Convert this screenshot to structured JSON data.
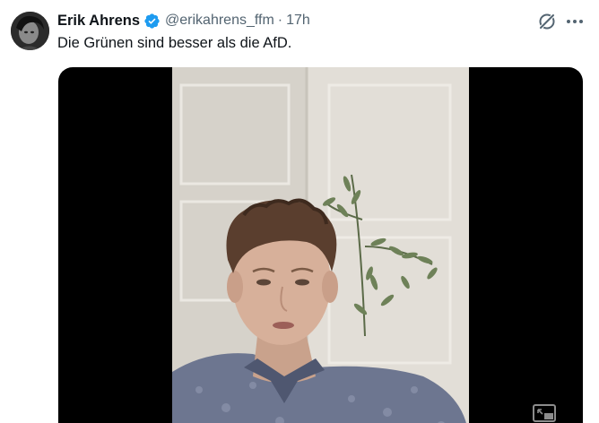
{
  "tweet": {
    "author_name": "Erik Ahrens",
    "handle": "@erikahrens_ffm",
    "separator": "·",
    "time": "17h",
    "text": "Die Grünen sind besser als die AfD."
  },
  "icons": {
    "verified": "verified-badge-icon",
    "grok": "grok-icon",
    "more": "more-options-icon",
    "pip": "picture-in-picture-icon"
  },
  "colors": {
    "text_primary": "#0f1419",
    "text_secondary": "#536471",
    "verified_blue": "#1d9bf0",
    "media_bg": "#000000"
  }
}
